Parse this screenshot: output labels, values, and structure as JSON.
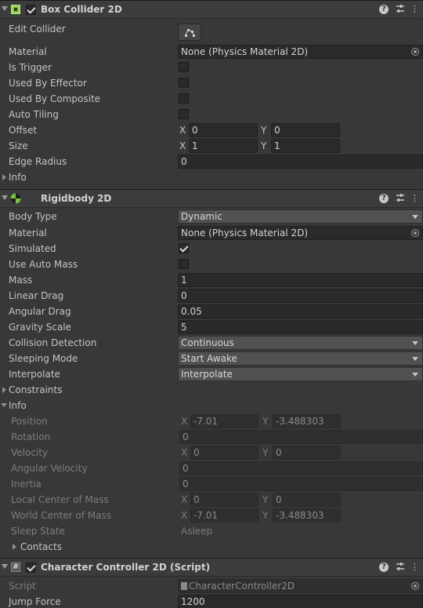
{
  "box_collider": {
    "title": "Box Collider 2D",
    "edit_collider_label": "Edit Collider",
    "material_label": "Material",
    "material_value": "None (Physics Material 2D)",
    "is_trigger_label": "Is Trigger",
    "used_by_effector_label": "Used By Effector",
    "used_by_composite_label": "Used By Composite",
    "auto_tiling_label": "Auto Tiling",
    "offset_label": "Offset",
    "offset_x": "0",
    "offset_y": "0",
    "size_label": "Size",
    "size_x": "1",
    "size_y": "1",
    "edge_radius_label": "Edge Radius",
    "edge_radius_value": "0",
    "info_label": "Info"
  },
  "rigidbody": {
    "title": "Rigidbody 2D",
    "body_type_label": "Body Type",
    "body_type_value": "Dynamic",
    "material_label": "Material",
    "material_value": "None (Physics Material 2D)",
    "simulated_label": "Simulated",
    "use_auto_mass_label": "Use Auto Mass",
    "mass_label": "Mass",
    "mass_value": "1",
    "linear_drag_label": "Linear Drag",
    "linear_drag_value": "0",
    "angular_drag_label": "Angular Drag",
    "angular_drag_value": "0.05",
    "gravity_scale_label": "Gravity Scale",
    "gravity_scale_value": "5",
    "collision_detection_label": "Collision Detection",
    "collision_detection_value": "Continuous",
    "sleeping_mode_label": "Sleeping Mode",
    "sleeping_mode_value": "Start Awake",
    "interpolate_label": "Interpolate",
    "interpolate_value": "Interpolate",
    "constraints_label": "Constraints",
    "info_label": "Info",
    "info": {
      "position_label": "Position",
      "position_x": "-7.01",
      "position_y": "-3.488303",
      "rotation_label": "Rotation",
      "rotation_value": "0",
      "velocity_label": "Velocity",
      "velocity_x": "0",
      "velocity_y": "0",
      "angular_velocity_label": "Angular Velocity",
      "angular_velocity_value": "0",
      "inertia_label": "Inertia",
      "inertia_value": "0",
      "local_com_label": "Local Center of Mass",
      "local_com_x": "0",
      "local_com_y": "0",
      "world_com_label": "World Center of Mass",
      "world_com_x": "-7.01",
      "world_com_y": "-3.488303",
      "sleep_state_label": "Sleep State",
      "sleep_state_value": "Asleep",
      "contacts_label": "Contacts"
    }
  },
  "character_controller": {
    "title": "Character Controller 2D (Script)",
    "script_label": "Script",
    "script_value": "CharacterController2D",
    "jump_force_label": "Jump Force",
    "jump_force_value": "1200"
  },
  "axis": {
    "x": "X",
    "y": "Y"
  },
  "header_icons": {
    "help": "?",
    "menu": "⋮"
  },
  "icons": [
    "box-collider-icon",
    "rigidbody-icon",
    "script-hash-icon",
    "help-icon",
    "preset-icon",
    "kebab-menu-icon",
    "edit-collider-icon",
    "object-picker-icon"
  ],
  "colors": {
    "background": "#383838",
    "field": "#2a2a2a",
    "dropdown": "#515151",
    "header": "#3c3c3c",
    "collider_icon": "#8bc34a",
    "rigidbody_icon": "#7fbf3f"
  }
}
